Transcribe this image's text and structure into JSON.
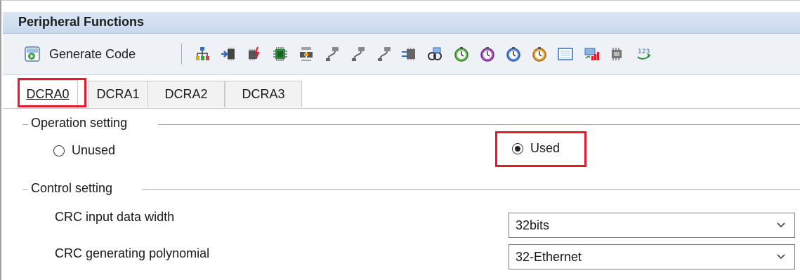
{
  "panel": {
    "title": "Peripheral Functions"
  },
  "toolbar": {
    "generate_label": "Generate Code",
    "icons": [
      "generate-code-icon",
      "clock-tree-icon",
      "port-icon",
      "interrupt-icon",
      "chip-icon",
      "dma-icon",
      "serial-icon",
      "serial-2-icon",
      "serial-3-icon",
      "io-icon",
      "link-icon",
      "timer-icon",
      "timer-2-icon",
      "timer-3-icon",
      "timer-4-icon",
      "display-icon",
      "signal-icon",
      "memory-icon",
      "counter-icon"
    ]
  },
  "tabs": [
    {
      "label": "DCRA0",
      "active": true
    },
    {
      "label": "DCRA1",
      "active": false
    },
    {
      "label": "DCRA2",
      "active": false
    },
    {
      "label": "DCRA3",
      "active": false
    }
  ],
  "operation": {
    "legend": "Operation setting",
    "unused_label": "Unused",
    "used_label": "Used",
    "selected": "Used"
  },
  "control": {
    "legend": "Control setting",
    "width_label": "CRC input data width",
    "width_value": "32bits",
    "poly_label": "CRC generating polynomial",
    "poly_value": "32-Ethernet"
  },
  "colors": {
    "highlight": "#e8192c",
    "titlebar": "#c9d9ee"
  }
}
